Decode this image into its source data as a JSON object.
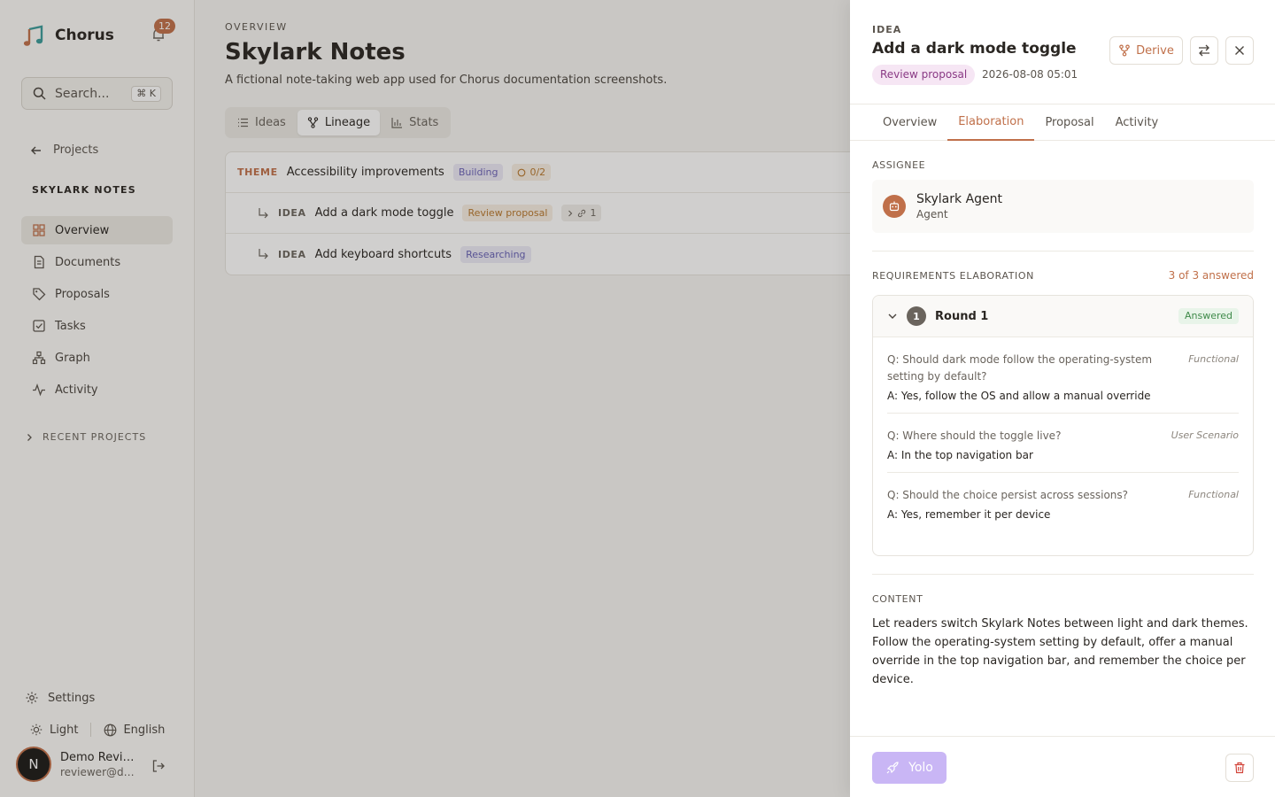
{
  "sidebar": {
    "brand": "Chorus",
    "notification_count": "12",
    "search": {
      "placeholder": "Search...",
      "shortcut": "⌘ K"
    },
    "back_label": "Projects",
    "section_title": "SKYLARK NOTES",
    "items": [
      {
        "label": "Overview",
        "icon": "dashboard-icon",
        "active": true
      },
      {
        "label": "Documents",
        "icon": "document-icon"
      },
      {
        "label": "Proposals",
        "icon": "tag-icon"
      },
      {
        "label": "Tasks",
        "icon": "checkbox-icon"
      },
      {
        "label": "Graph",
        "icon": "graph-icon"
      },
      {
        "label": "Activity",
        "icon": "activity-icon"
      }
    ],
    "recent_projects": "RECENT PROJECTS",
    "settings": "Settings",
    "theme": "Light",
    "language": "English",
    "user": {
      "initial": "N",
      "name": "Demo Reviewer",
      "email": "reviewer@demo.com"
    }
  },
  "main": {
    "eyebrow": "OVERVIEW",
    "title": "Skylark Notes",
    "description": "A fictional note-taking web app used for Chorus documentation screenshots.",
    "tabs": [
      {
        "label": "Ideas",
        "icon": "list-icon"
      },
      {
        "label": "Lineage",
        "icon": "lineage-icon",
        "active": true
      },
      {
        "label": "Stats",
        "icon": "bar-chart-icon"
      }
    ],
    "tree": {
      "theme": {
        "kind": "THEME",
        "title": "Accessibility improvements",
        "status": "Building",
        "progress": "0/2"
      },
      "children": [
        {
          "kind": "IDEA",
          "title": "Add a dark mode toggle",
          "status": "Review proposal",
          "links": "1"
        },
        {
          "kind": "IDEA",
          "title": "Add keyboard shortcuts",
          "status": "Researching"
        }
      ]
    }
  },
  "drawer": {
    "kind": "IDEA",
    "title": "Add a dark mode toggle",
    "status": "Review proposal",
    "date": "2026-08-08 05:01",
    "derive_label": "Derive",
    "tabs": [
      "Overview",
      "Elaboration",
      "Proposal",
      "Activity"
    ],
    "active_tab": "Elaboration",
    "assignee_label": "ASSIGNEE",
    "assignee": {
      "name": "Skylark Agent",
      "role": "Agent"
    },
    "requirements_label": "REQUIREMENTS ELABORATION",
    "answered_count": "3 of 3 answered",
    "round": {
      "number": "1",
      "title": "Round 1",
      "badge": "Answered",
      "qa": [
        {
          "q": "Q: Should dark mode follow the operating-system setting by default?",
          "a": "A: Yes, follow the OS and allow a manual override",
          "category": "Functional"
        },
        {
          "q": "Q: Where should the toggle live?",
          "a": "A: In the top navigation bar",
          "category": "User Scenario"
        },
        {
          "q": "Q: Should the choice persist across sessions?",
          "a": "A: Yes, remember it per device",
          "category": "Functional"
        }
      ]
    },
    "content_label": "CONTENT",
    "content": "Let readers switch Skylark Notes between light and dark themes. Follow the operating-system setting by default, offer a manual override in the top navigation bar, and remember the choice per device.",
    "yolo_label": "Yolo"
  },
  "colors": {
    "accent": "#c0704a",
    "yolo": "#c9b6f5",
    "answered": "#3f8a4a"
  }
}
